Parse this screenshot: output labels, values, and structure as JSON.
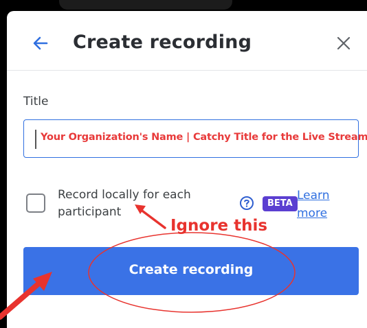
{
  "dialog": {
    "title": "Create recording"
  },
  "form": {
    "title_label": "Title",
    "title_value": "Your Organization's Name | Catchy Title for the Live Stream",
    "record_locally_label": "Record locally for each participant",
    "beta_badge": "BETA",
    "learn_more": "Learn more",
    "create_button": "Create recording"
  },
  "annotation": {
    "note": "Ignore this"
  },
  "icons": {
    "back": "arrow-left-icon",
    "close": "close-icon",
    "help": "help-circle-icon"
  },
  "colors": {
    "accent": "#3a72e6",
    "link": "#2f6fe0",
    "beta": "#5b3fd1",
    "annotation_red": "#e8332e"
  }
}
